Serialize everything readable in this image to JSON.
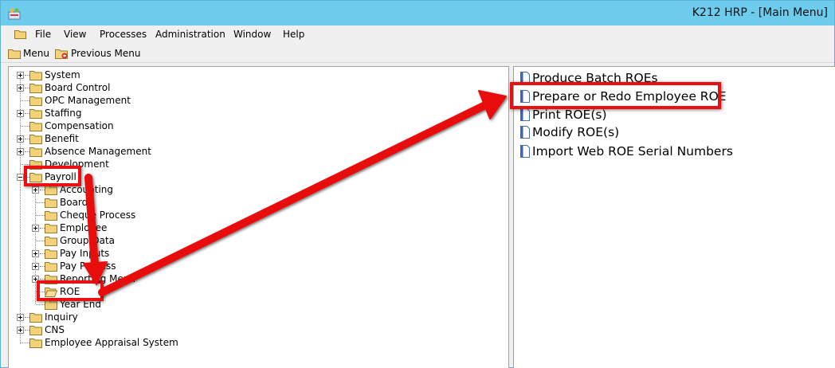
{
  "window": {
    "title": "K212 HRP - [Main Menu]"
  },
  "menubar": {
    "items": [
      "File",
      "View",
      "Processes",
      "Administration",
      "Window",
      "Help"
    ]
  },
  "toolbar": {
    "menu_label": "Menu",
    "previous_label": "Previous Menu"
  },
  "tree": {
    "top": [
      {
        "label": "System",
        "expandable": true
      },
      {
        "label": "Board Control",
        "expandable": true
      },
      {
        "label": "OPC Management",
        "expandable": false
      },
      {
        "label": "Staffing",
        "expandable": true
      },
      {
        "label": "Compensation",
        "expandable": false
      },
      {
        "label": "Benefit",
        "expandable": true
      },
      {
        "label": "Absence Management",
        "expandable": true
      },
      {
        "label": "Development",
        "expandable": false
      },
      {
        "label": "Payroll",
        "expandable": true,
        "expanded": true,
        "highlighted": true
      }
    ],
    "payroll_children": [
      {
        "label": "Accounting",
        "expandable": true
      },
      {
        "label": "Board",
        "expandable": false
      },
      {
        "label": "Cheque Process",
        "expandable": false
      },
      {
        "label": "Employee",
        "expandable": true
      },
      {
        "label": "Group Data",
        "expandable": false
      },
      {
        "label": "Pay Inputs",
        "expandable": true
      },
      {
        "label": "Pay Process",
        "expandable": true
      },
      {
        "label": "Reporting Menu",
        "expandable": true
      },
      {
        "label": "ROE",
        "expandable": false,
        "selected": true,
        "highlighted": true
      },
      {
        "label": "Year End",
        "expandable": false
      }
    ],
    "bottom": [
      {
        "label": "Inquiry",
        "expandable": true
      },
      {
        "label": "CNS",
        "expandable": true
      },
      {
        "label": "Employee Appraisal System",
        "expandable": false
      }
    ]
  },
  "right_menu": {
    "items": [
      {
        "label": "Produce Batch ROEs"
      },
      {
        "label": "Prepare or Redo Employee ROE",
        "highlighted": true
      },
      {
        "label": "Print ROE(s)"
      },
      {
        "label": "Modify ROE(s)"
      },
      {
        "label": "Import Web ROE Serial Numbers"
      }
    ]
  },
  "colors": {
    "titlebar": "#6dccec",
    "highlight": "#e81010",
    "folder": "#f4d27a"
  }
}
